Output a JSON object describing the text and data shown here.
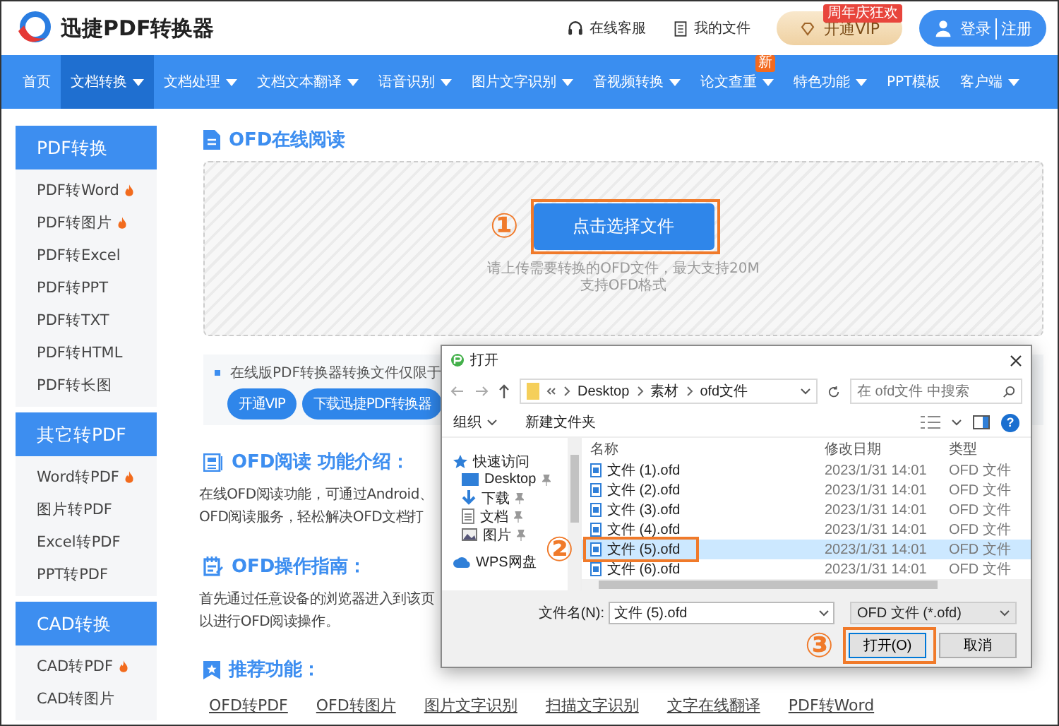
{
  "header": {
    "logo": "迅捷PDF转换器",
    "links": [
      "在线客服",
      "我的文件"
    ],
    "vip": {
      "label": "开通VIP",
      "badge": "周年庆狂欢"
    },
    "login": "登录",
    "register": "注册"
  },
  "nav": [
    {
      "label": "首页",
      "selected": false,
      "dropdown": false
    },
    {
      "label": "文档转换",
      "selected": true,
      "dropdown": true
    },
    {
      "label": "文档处理",
      "selected": false,
      "dropdown": true
    },
    {
      "label": "文档文本翻译",
      "selected": false,
      "dropdown": true
    },
    {
      "label": "语音识别",
      "selected": false,
      "dropdown": true
    },
    {
      "label": "图片文字识别",
      "selected": false,
      "dropdown": true
    },
    {
      "label": "音视频转换",
      "selected": false,
      "dropdown": true
    },
    {
      "label": "论文查重",
      "selected": false,
      "dropdown": true,
      "badge": "新"
    },
    {
      "label": "特色功能",
      "selected": false,
      "dropdown": true
    },
    {
      "label": "PPT模板",
      "selected": false,
      "dropdown": false
    },
    {
      "label": "客户端",
      "selected": false,
      "dropdown": true
    }
  ],
  "sidebar": [
    {
      "title": "PDF转换",
      "items": [
        {
          "label": "PDF转Word",
          "hot": true
        },
        {
          "label": "PDF转图片",
          "hot": true
        },
        {
          "label": "PDF转Excel",
          "hot": false
        },
        {
          "label": "PDF转PPT",
          "hot": false
        },
        {
          "label": "PDF转TXT",
          "hot": false
        },
        {
          "label": "PDF转HTML",
          "hot": false
        },
        {
          "label": "PDF转长图",
          "hot": false
        }
      ]
    },
    {
      "title": "其它转PDF",
      "items": [
        {
          "label": "Word转PDF",
          "hot": true
        },
        {
          "label": "图片转PDF",
          "hot": false
        },
        {
          "label": "Excel转PDF",
          "hot": false
        },
        {
          "label": "PPT转PDF",
          "hot": false
        }
      ]
    },
    {
      "title": "CAD转换",
      "items": [
        {
          "label": "CAD转PDF",
          "hot": true
        },
        {
          "label": "CAD转图片",
          "hot": false
        }
      ]
    }
  ],
  "main": {
    "title": "OFD在线阅读",
    "upload": {
      "button": "点击选择文件",
      "hints": [
        "请上传需要转换的OFD文件，最大支持20M",
        "支持OFD格式"
      ]
    },
    "notice": {
      "text": "在线版PDF转换器转换文件仅限于",
      "buttons": [
        "开通VIP",
        "下载迅捷PDF转换器"
      ]
    },
    "sections": [
      {
        "title": "OFD阅读 功能介绍：",
        "lines": [
          "在线OFD阅读功能，可通过Android、",
          "OFD阅读服务，轻松解决OFD文档打"
        ]
      },
      {
        "title": "OFD操作指南：",
        "lines": [
          "首先通过任意设备的浏览器进入到该页",
          "以进行OFD阅读操作。"
        ]
      },
      {
        "title": "推荐功能：",
        "links": [
          "OFD转PDF",
          "OFD转图片",
          "图片文字识别",
          "扫描文字识别",
          "文字在线翻译",
          "PDF转Word"
        ]
      }
    ]
  },
  "dialog": {
    "title": "打开",
    "path": [
      "Desktop",
      "素材",
      "ofd文件"
    ],
    "search_placeholder": "在 ofd文件 中搜索",
    "toolbar": [
      "组织",
      "新建文件夹"
    ],
    "help": "?",
    "tree": [
      {
        "label": "快速访问",
        "children": [
          {
            "label": "Desktop",
            "pinned": true
          },
          {
            "label": "下载",
            "pinned": true
          },
          {
            "label": "文档",
            "pinned": true
          },
          {
            "label": "图片",
            "pinned": true
          }
        ]
      },
      {
        "label": "WPS网盘"
      }
    ],
    "columns": [
      "名称",
      "修改日期",
      "类型"
    ],
    "files": [
      {
        "name": "文件 (1).ofd",
        "modified": "2023/1/31 14:01",
        "type": "OFD 文件",
        "selected": false
      },
      {
        "name": "文件 (2).ofd",
        "modified": "2023/1/31 14:01",
        "type": "OFD 文件",
        "selected": false
      },
      {
        "name": "文件 (3).ofd",
        "modified": "2023/1/31 14:01",
        "type": "OFD 文件",
        "selected": false
      },
      {
        "name": "文件 (4).ofd",
        "modified": "2023/1/31 14:01",
        "type": "OFD 文件",
        "selected": false
      },
      {
        "name": "文件 (5).ofd",
        "modified": "2023/1/31 14:01",
        "type": "OFD 文件",
        "selected": true
      },
      {
        "name": "文件 (6).ofd",
        "modified": "2023/1/31 14:01",
        "type": "OFD 文件",
        "selected": false
      }
    ],
    "filename_label": "文件名(N):",
    "filename": "文件 (5).ofd",
    "filter": "OFD 文件 (*.ofd)",
    "buttons": [
      "打开(O)",
      "取消"
    ]
  },
  "annotations": [
    {
      "number": "①"
    },
    {
      "number": "②"
    },
    {
      "number": "③"
    }
  ]
}
